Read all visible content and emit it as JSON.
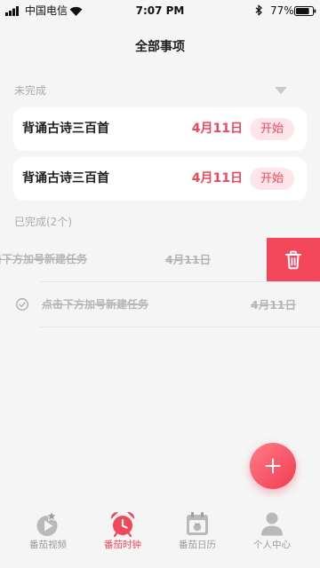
{
  "status_bar": {
    "carrier": "中国电信",
    "time": "7:07 PM",
    "battery": "77%",
    "icons": [
      "signal-icon",
      "wifi-icon",
      "bluetooth-icon",
      "battery-icon"
    ]
  },
  "header": {
    "title": "全部事项"
  },
  "incomplete": {
    "label": "未完成",
    "toggle_icon": "chevron-down-icon",
    "items": [
      {
        "title": "背诵古诗三百首",
        "date": "4月11日",
        "action": "开始"
      },
      {
        "title": "背诵古诗三百首",
        "date": "4月11日",
        "action": "开始"
      }
    ]
  },
  "completed": {
    "label": "已完成(2个)",
    "items": [
      {
        "title": "点击下方加号新建任务",
        "date": "4月11日",
        "delete_icon": "trash-icon"
      },
      {
        "title": "点击下方加号新建任务",
        "date": "4月11日",
        "status_icon": "check-circle-icon"
      }
    ]
  },
  "fab": {
    "icon": "plus-icon"
  },
  "tab_bar": {
    "active_index": 1,
    "tabs": [
      {
        "label": "番茄视频",
        "icon": "tomato-video-icon"
      },
      {
        "label": "番茄时钟",
        "icon": "alarm-clock-icon"
      },
      {
        "label": "番茄日历",
        "icon": "calendar-icon"
      },
      {
        "label": "个人中心",
        "icon": "person-icon"
      }
    ]
  },
  "colors": {
    "accent": "#f2475b",
    "background": "#f5f5f5",
    "card": "#ffffff",
    "muted_text": "#aaaaaa",
    "completed_text": "#b5b5b5",
    "start_button_bg": "#fde5e9",
    "delete_bg": "#f4475c",
    "inactive_tab": "#9a9a9a"
  }
}
